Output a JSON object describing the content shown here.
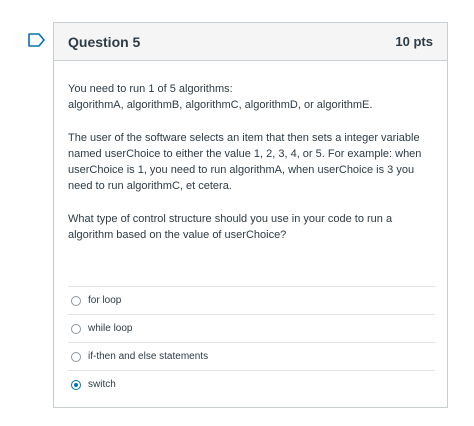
{
  "question": {
    "title": "Question 5",
    "points": "10 pts",
    "paragraphs": [
      "You need to run 1 of 5 algorithms:\nalgorithmA, algorithmB, algorithmC, algorithmD, or algorithmE.",
      "The user of the software selects an item that then sets a integer variable named userChoice to either the value 1, 2, 3, 4, or 5.  For example: when userChoice is 1, you need to run algorithmA, when userChoice is 3 you need to run algorithmC, et cetera.",
      "What type of control structure should you use in your code to run a algorithm based on the value of userChoice?"
    ],
    "answers": [
      {
        "label": "for loop",
        "selected": false
      },
      {
        "label": "while loop",
        "selected": false
      },
      {
        "label": "if-then and else statements",
        "selected": false
      },
      {
        "label": "switch",
        "selected": true
      }
    ]
  },
  "colors": {
    "accent": "#0374b5",
    "text": "#2d3b45",
    "header_bg": "#f5f5f5",
    "border": "#c7cdd1"
  },
  "icons": {
    "flag": "bookmark-flag-icon"
  }
}
